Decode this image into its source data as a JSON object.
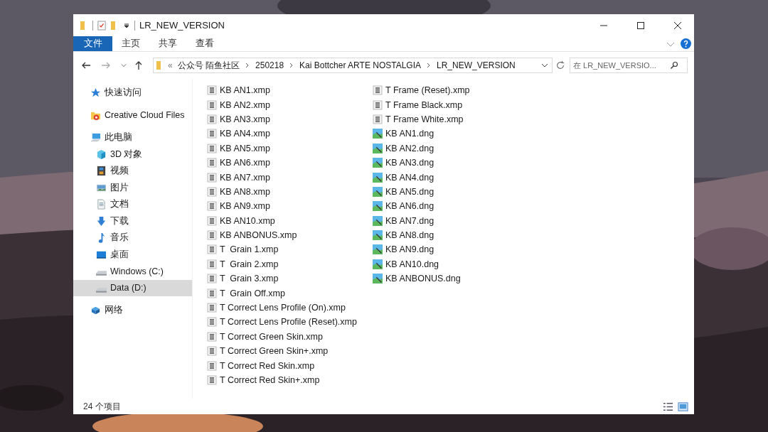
{
  "window": {
    "title": "LR_NEW_VERSION"
  },
  "ribbon_tabs": [
    {
      "label": "文件",
      "selected": true
    },
    {
      "label": "主页",
      "selected": false
    },
    {
      "label": "共享",
      "selected": false
    },
    {
      "label": "查看",
      "selected": false
    }
  ],
  "address": {
    "overflow": "«",
    "segments": [
      "公众号 陌鱼社区",
      "250218",
      "Kai Bottcher ARTE NOSTALGIA",
      "LR_NEW_VERSION"
    ]
  },
  "search": {
    "placeholder": "在 LR_NEW_VERSIO..."
  },
  "sidebar": {
    "items": [
      {
        "label": "快速访问",
        "kind": "star",
        "selected": false
      },
      {
        "label": "Creative Cloud Files",
        "kind": "cloud",
        "selected": false
      },
      {
        "label": "此电脑",
        "kind": "pc",
        "selected": false,
        "children": [
          {
            "label": "3D 对象",
            "kind": "cube",
            "selected": false
          },
          {
            "label": "视频",
            "kind": "video",
            "selected": false
          },
          {
            "label": "图片",
            "kind": "pictures",
            "selected": false
          },
          {
            "label": "文档",
            "kind": "document",
            "selected": false
          },
          {
            "label": "下载",
            "kind": "download",
            "selected": false
          },
          {
            "label": "音乐",
            "kind": "music",
            "selected": false
          },
          {
            "label": "桌面",
            "kind": "desktop",
            "selected": false
          },
          {
            "label": "Windows (C:)",
            "kind": "drive",
            "selected": false
          },
          {
            "label": "Data (D:)",
            "kind": "drive",
            "selected": true
          }
        ]
      },
      {
        "label": "网络",
        "kind": "network",
        "selected": false
      }
    ]
  },
  "files": [
    {
      "name": "KB AN1.xmp",
      "kind": "xmp"
    },
    {
      "name": "KB AN2.xmp",
      "kind": "xmp"
    },
    {
      "name": "KB AN3.xmp",
      "kind": "xmp"
    },
    {
      "name": "KB AN4.xmp",
      "kind": "xmp"
    },
    {
      "name": "KB AN5.xmp",
      "kind": "xmp"
    },
    {
      "name": "KB AN6.xmp",
      "kind": "xmp"
    },
    {
      "name": "KB AN7.xmp",
      "kind": "xmp"
    },
    {
      "name": "KB AN8.xmp",
      "kind": "xmp"
    },
    {
      "name": "KB AN9.xmp",
      "kind": "xmp"
    },
    {
      "name": "KB AN10.xmp",
      "kind": "xmp"
    },
    {
      "name": "KB ANBONUS.xmp",
      "kind": "xmp"
    },
    {
      "name": "T  Grain 1.xmp",
      "kind": "xmp"
    },
    {
      "name": "T  Grain 2.xmp",
      "kind": "xmp"
    },
    {
      "name": "T  Grain 3.xmp",
      "kind": "xmp"
    },
    {
      "name": "T  Grain Off.xmp",
      "kind": "xmp"
    },
    {
      "name": "T Correct Lens Profile (On).xmp",
      "kind": "xmp"
    },
    {
      "name": "T Correct Lens Profile (Reset).xmp",
      "kind": "xmp"
    },
    {
      "name": "T Correct Green Skin.xmp",
      "kind": "xmp"
    },
    {
      "name": "T Correct Green Skin+.xmp",
      "kind": "xmp"
    },
    {
      "name": "T Correct Red Skin.xmp",
      "kind": "xmp"
    },
    {
      "name": "T Correct Red Skin+.xmp",
      "kind": "xmp"
    },
    {
      "name": "T Frame (Reset).xmp",
      "kind": "xmp"
    },
    {
      "name": "T Frame Black.xmp",
      "kind": "xmp"
    },
    {
      "name": "T Frame White.xmp",
      "kind": "xmp"
    },
    {
      "name": "KB AN1.dng",
      "kind": "dng"
    },
    {
      "name": "KB AN2.dng",
      "kind": "dng"
    },
    {
      "name": "KB AN3.dng",
      "kind": "dng"
    },
    {
      "name": "KB AN4.dng",
      "kind": "dng"
    },
    {
      "name": "KB AN5.dng",
      "kind": "dng"
    },
    {
      "name": "KB AN6.dng",
      "kind": "dng"
    },
    {
      "name": "KB AN7.dng",
      "kind": "dng"
    },
    {
      "name": "KB AN8.dng",
      "kind": "dng"
    },
    {
      "name": "KB AN9.dng",
      "kind": "dng"
    },
    {
      "name": "KB AN10.dng",
      "kind": "dng"
    },
    {
      "name": "KB ANBONUS.dng",
      "kind": "dng"
    }
  ],
  "status_bar": {
    "count": "24 个项目"
  }
}
